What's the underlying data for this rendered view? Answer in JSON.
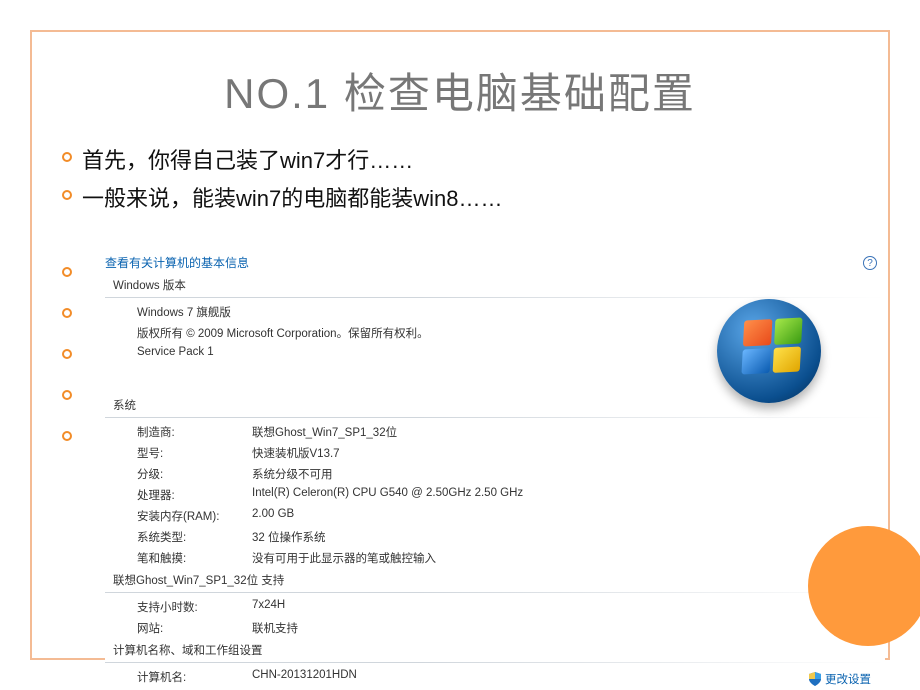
{
  "slide": {
    "title": "NO.1    检查电脑基础配置",
    "bullets": [
      "首先，你得自己装了win7才行……",
      "一般来说，能装win7的电脑都能装win8……"
    ]
  },
  "sysinfo": {
    "header": "查看有关计算机的基本信息",
    "edition_section": "Windows 版本",
    "edition": "Windows 7 旗舰版",
    "copyright": "版权所有 © 2009 Microsoft Corporation。保留所有权利。",
    "service_pack": "Service Pack 1",
    "system_section": "系统",
    "rows": {
      "manufacturer_k": "制造商:",
      "manufacturer_v": "联想Ghost_Win7_SP1_32位",
      "model_k": "型号:",
      "model_v": "快速装机版V13.7",
      "rating_k": "分级:",
      "rating_v": "系统分级不可用",
      "processor_k": "处理器:",
      "processor_v": "Intel(R) Celeron(R) CPU G540 @ 2.50GHz   2.50 GHz",
      "ram_k": "安装内存(RAM):",
      "ram_v": "2.00 GB",
      "systype_k": "系统类型:",
      "systype_v": "32 位操作系统",
      "pentouch_k": "笔和触摸:",
      "pentouch_v": "没有可用于此显示器的笔或触控输入"
    },
    "support_section": "联想Ghost_Win7_SP1_32位 支持",
    "support": {
      "hours_k": "支持小时数:",
      "hours_v": "7x24H",
      "site_k": "网站:",
      "site_v": "联机支持"
    },
    "name_section": "计算机名称、域和工作组设置",
    "name": {
      "computer_k": "计算机名:",
      "computer_v": "CHN-20131201HDN"
    },
    "change_settings": "更改设置",
    "help": "?"
  }
}
